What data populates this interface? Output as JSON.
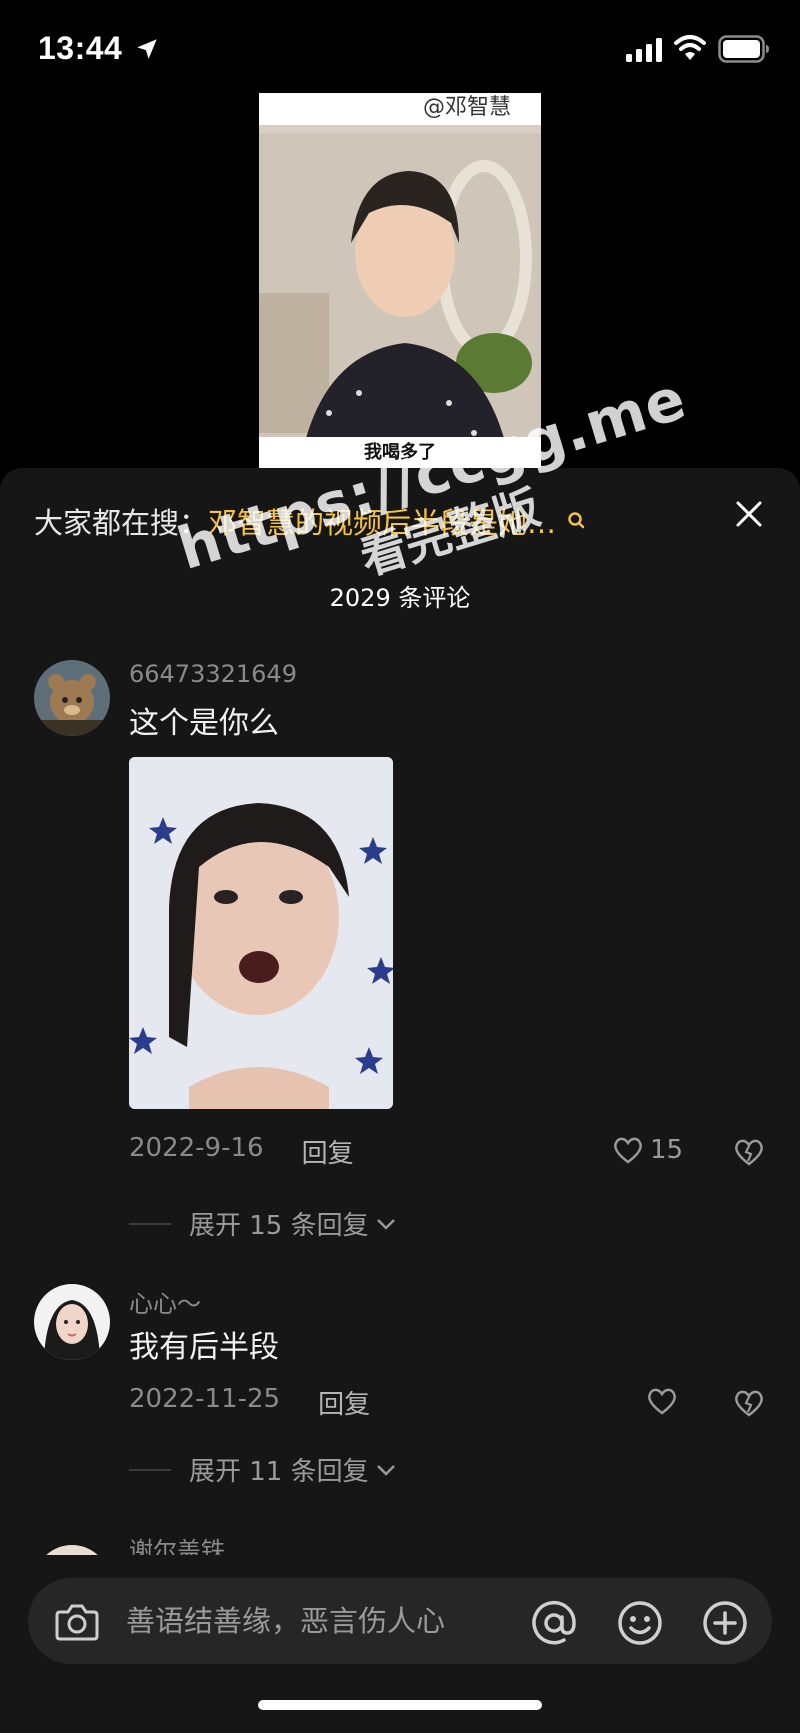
{
  "status_bar": {
    "time": "13:44",
    "icons": [
      "location-arrow-icon",
      "signal-icon",
      "wifi-icon",
      "battery-icon"
    ]
  },
  "video": {
    "handle_tag": "@邓智慧",
    "caption": "我喝多了"
  },
  "sheet": {
    "trending_prefix": "大家都在搜：",
    "trending_link": "邓智慧的视频后半段是她…",
    "comment_count": "2029 条评论",
    "watermark_line1": "https://ccgg.me",
    "watermark_line2": "看完整版",
    "accent_color": "#f5c242"
  },
  "comments": [
    {
      "username": "66473321649",
      "text": "这个是你么",
      "has_image": true,
      "date": "2022-9-16",
      "reply_label": "回复",
      "likes": "15",
      "expand_label": "展开 15 条回复"
    },
    {
      "username": "心心～",
      "text": "我有后半段",
      "has_image": false,
      "date": "2022-11-25",
      "reply_label": "回复",
      "likes": "",
      "expand_label": "展开 11 条回复"
    },
    {
      "username": "谢尔盖铁"
    }
  ],
  "input_bar": {
    "placeholder": "善语结善缘，恶言伤人心",
    "icons": [
      "camera-icon",
      "at-icon",
      "emoji-icon",
      "plus-icon"
    ]
  }
}
